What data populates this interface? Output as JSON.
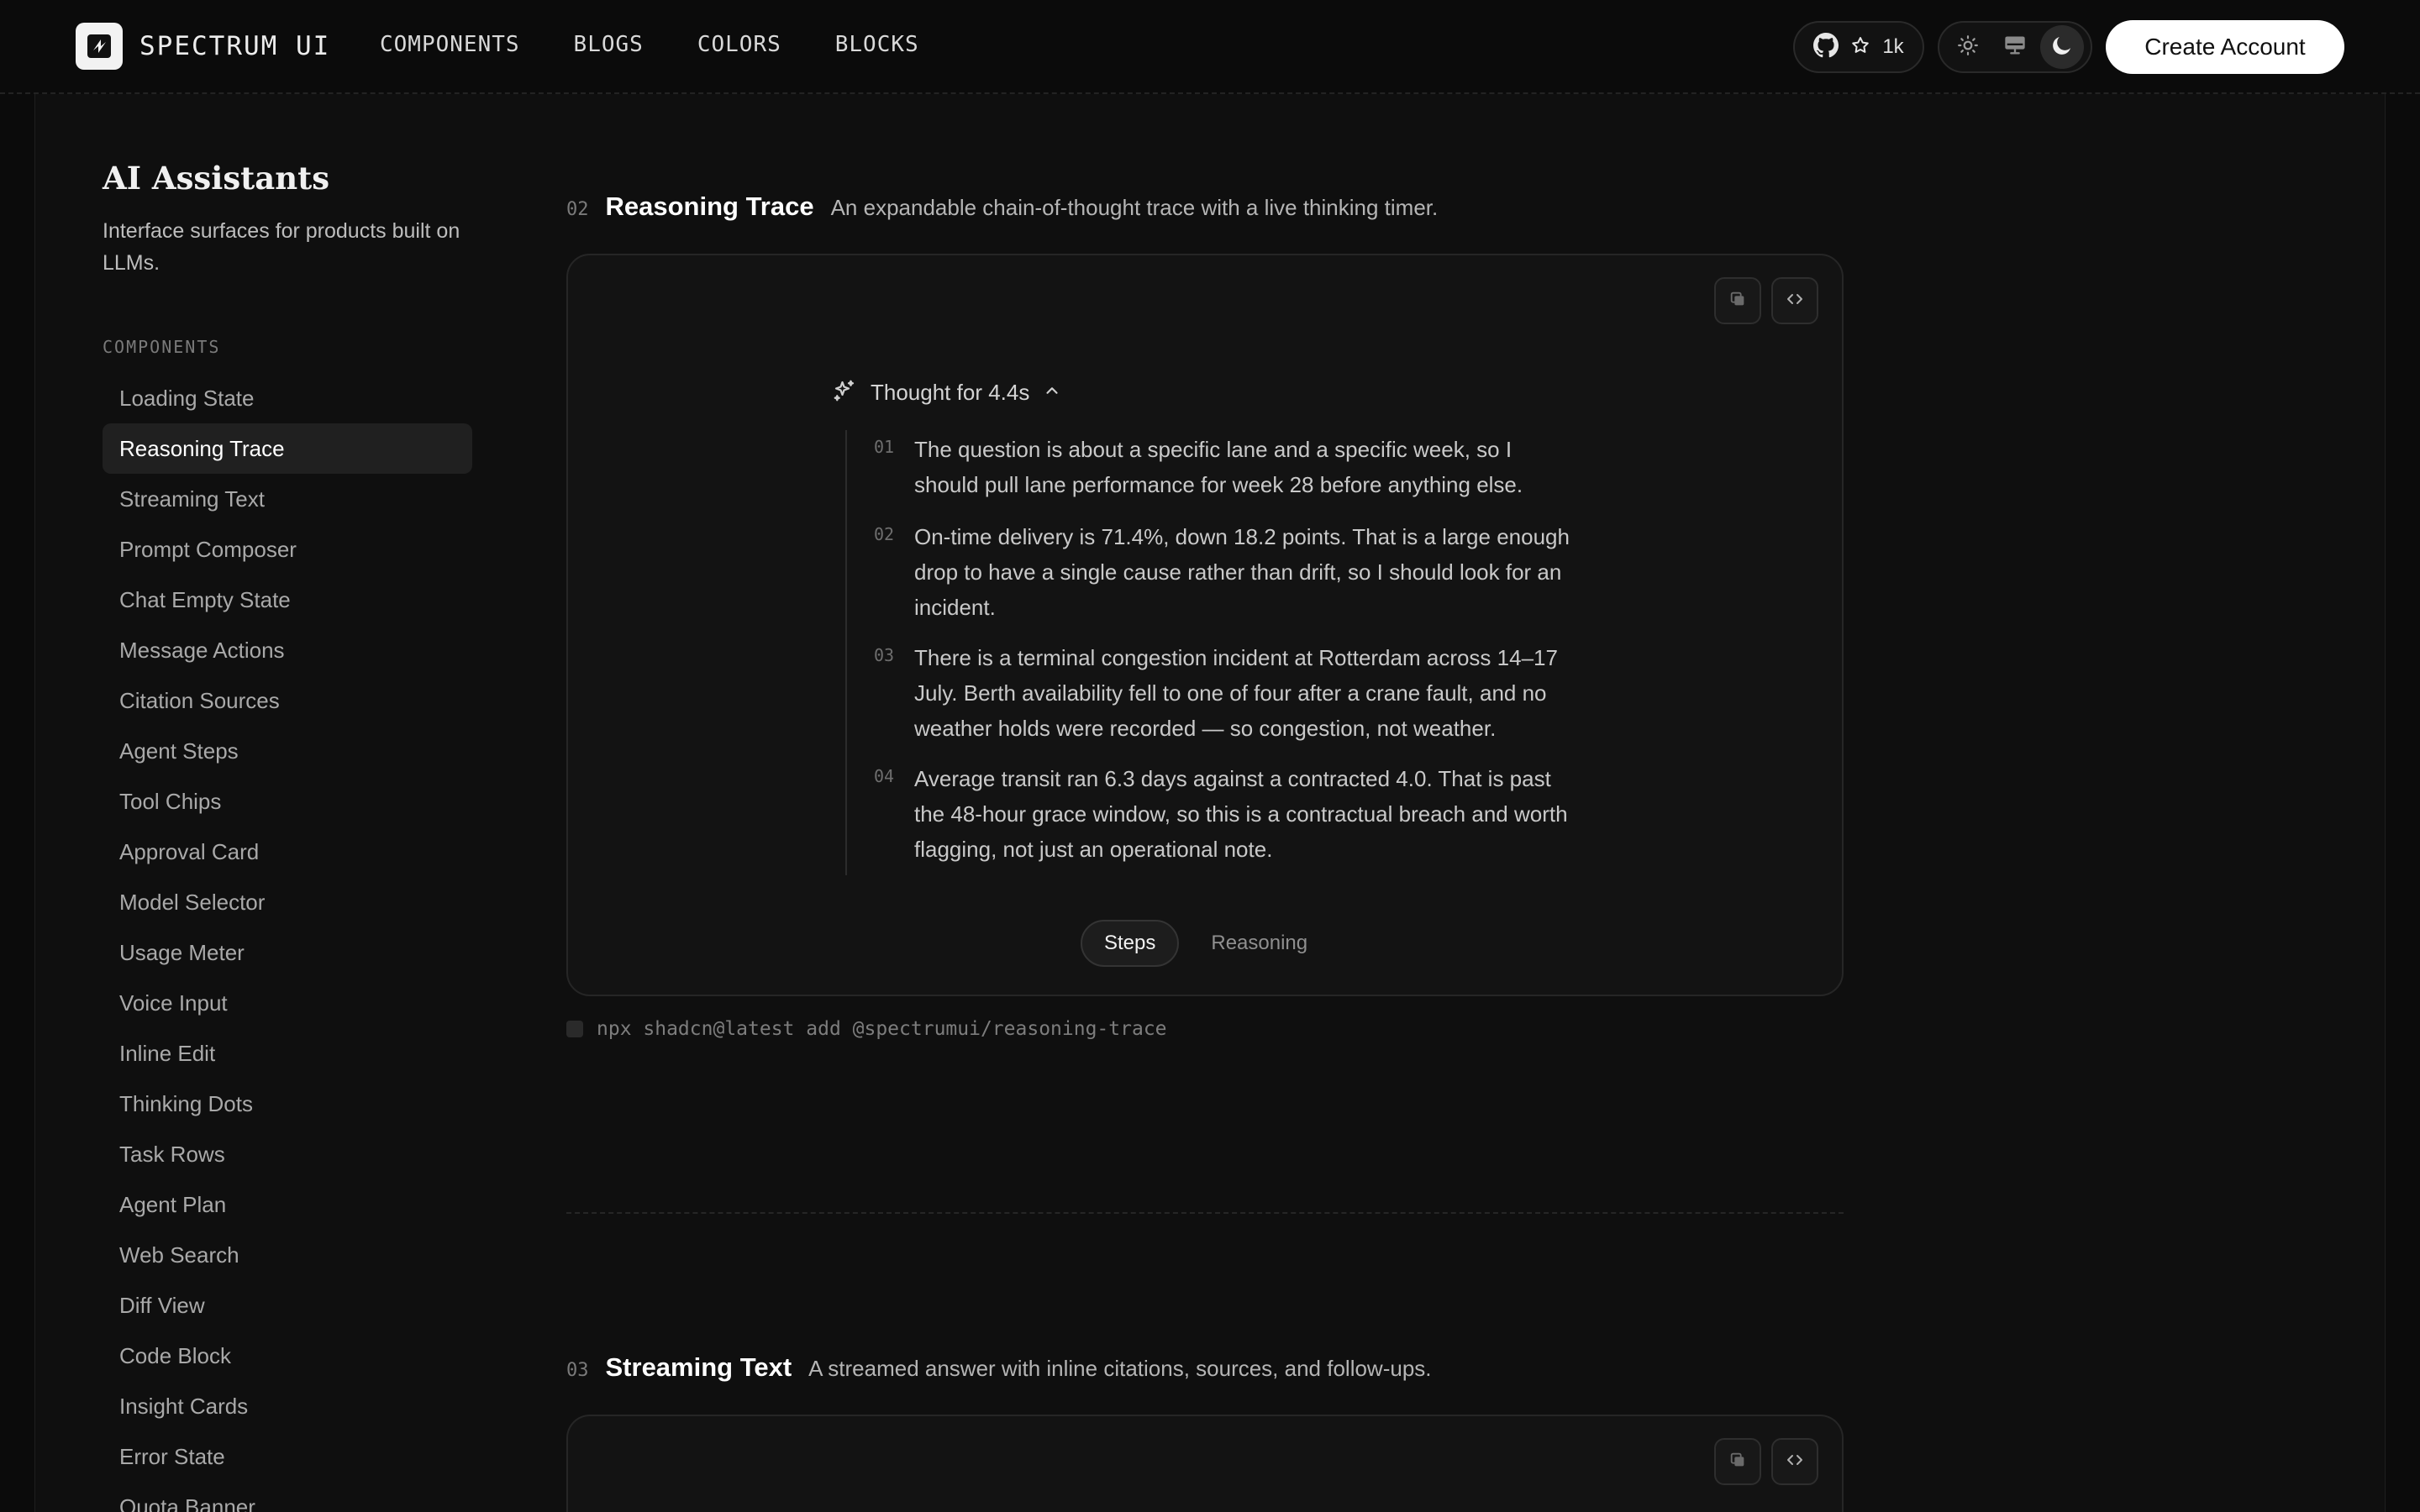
{
  "header": {
    "brand": "SPECTRUM UI",
    "nav": [
      "COMPONENTS",
      "BLOGS",
      "COLORS",
      "BLOCKS"
    ],
    "github_stars": "1k",
    "theme_options": [
      "sun-icon",
      "monitor-icon",
      "moon-icon"
    ],
    "active_theme": "dark",
    "create_account": "Create Account"
  },
  "sidebar": {
    "title": "AI Assistants",
    "description": "Interface surfaces for products built on LLMs.",
    "section": "COMPONENTS",
    "items": [
      {
        "label": "Loading State"
      },
      {
        "label": "Reasoning Trace",
        "active": true
      },
      {
        "label": "Streaming Text"
      },
      {
        "label": "Prompt Composer"
      },
      {
        "label": "Chat Empty State"
      },
      {
        "label": "Message Actions"
      },
      {
        "label": "Citation Sources"
      },
      {
        "label": "Agent Steps"
      },
      {
        "label": "Tool Chips"
      },
      {
        "label": "Approval Card"
      },
      {
        "label": "Model Selector"
      },
      {
        "label": "Usage Meter"
      },
      {
        "label": "Voice Input"
      },
      {
        "label": "Inline Edit"
      },
      {
        "label": "Thinking Dots"
      },
      {
        "label": "Task Rows"
      },
      {
        "label": "Agent Plan"
      },
      {
        "label": "Web Search"
      },
      {
        "label": "Diff View"
      },
      {
        "label": "Code Block"
      },
      {
        "label": "Insight Cards"
      },
      {
        "label": "Error State"
      },
      {
        "label": "Quota Banner"
      }
    ]
  },
  "sections": [
    {
      "num": "02",
      "title": "Reasoning Trace",
      "description": "An expandable chain-of-thought trace with a live thinking timer.",
      "preview": {
        "thought_label": "Thought for 4.4s",
        "steps": [
          {
            "num": "01",
            "text": "The question is about a specific lane and a specific week, so I should pull lane performance for week 28 before anything else."
          },
          {
            "num": "02",
            "text": "On-time delivery is 71.4%, down 18.2 points. That is a large enough drop to have a single cause rather than drift, so I should look for an incident."
          },
          {
            "num": "03",
            "text": "There is a terminal congestion incident at Rotterdam across 14–17 July. Berth availability fell to one of four after a crane fault, and no weather holds were recorded — so congestion, not weather."
          },
          {
            "num": "04",
            "text": "Average transit ran 6.3 days against a contracted 4.0. That is past the 48-hour grace window, so this is a contractual breach and worth flagging, not just an operational note."
          }
        ],
        "tabs": [
          "Steps",
          "Reasoning"
        ],
        "active_tab": "Steps"
      },
      "install": "npx shadcn@latest add @spectrumui/reasoning-trace"
    },
    {
      "num": "03",
      "title": "Streaming Text",
      "description": "A streamed answer with inline citations, sources, and follow-ups."
    }
  ]
}
